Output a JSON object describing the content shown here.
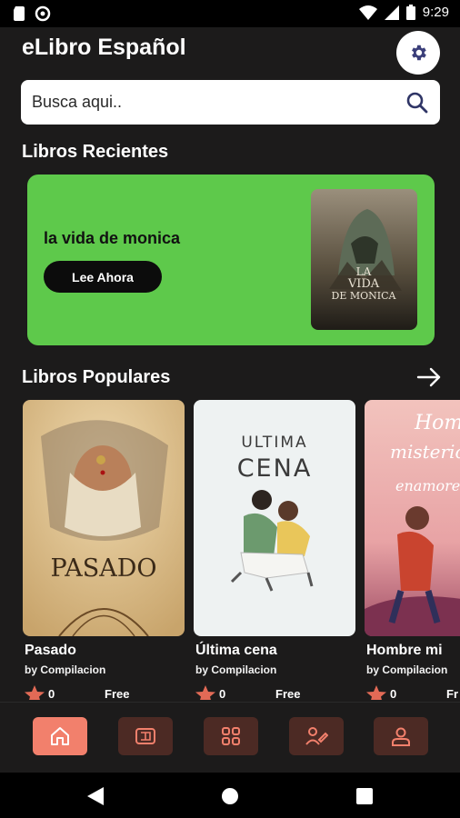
{
  "status_bar": {
    "time": "9:29",
    "icons": [
      "sd-card-icon",
      "sync-icon",
      "wifi-icon",
      "signal-icon",
      "battery-icon"
    ]
  },
  "header": {
    "title": "eLibro Español",
    "settings_icon": "gear-icon"
  },
  "search": {
    "placeholder": "Busca aqui..",
    "icon": "search-icon"
  },
  "recent": {
    "section_title": "Libros Recientes",
    "book_title": "la vida de monica",
    "button_label": "Lee Ahora",
    "cover_text": [
      "LA",
      "VIDA",
      "DE MONICA"
    ],
    "card_color": "#5ec94b"
  },
  "popular": {
    "section_title": "Libros Populares",
    "books": [
      {
        "title": "Pasado",
        "author": "by Compilacion",
        "likes": "0",
        "price": "Free",
        "cover_text": "PASADO"
      },
      {
        "title": "Última cena",
        "author": "by Compilacion",
        "likes": "0",
        "price": "Free",
        "cover_text_1": "ULTIMA",
        "cover_text_2": "CENA"
      },
      {
        "title": "Hombre mi",
        "author": "by Compilacion",
        "likes": "0",
        "price": "Fr",
        "cover_text_1": "Homb",
        "cover_text_2": "misterios",
        "cover_text_3": "enamorez"
      }
    ]
  },
  "bottom_nav": {
    "items": [
      "home-icon",
      "book-icon",
      "grid-icon",
      "writer-icon",
      "profile-icon"
    ],
    "active": "home-icon",
    "accent": "#f2806c"
  }
}
